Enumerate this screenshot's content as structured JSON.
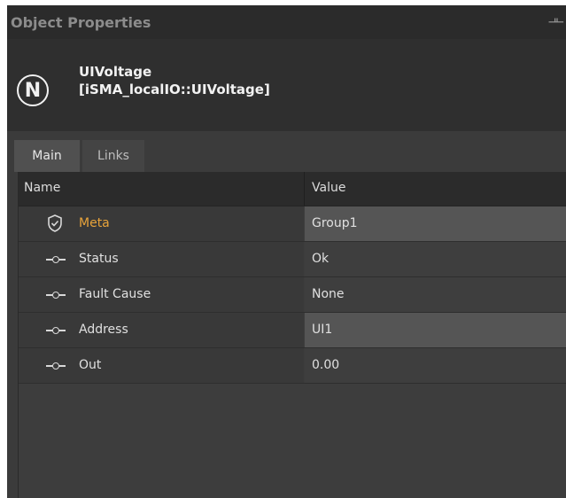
{
  "panel": {
    "title": "Object Properties",
    "pin_icon": "pin-icon"
  },
  "object": {
    "icon_letter": "N",
    "name": "UIVoltage",
    "type": "[iSMA_localIO::UIVoltage]"
  },
  "tabs": [
    {
      "label": "Main",
      "active": true
    },
    {
      "label": "Links",
      "active": false
    }
  ],
  "grid": {
    "columns": {
      "name": "Name",
      "value": "Value"
    },
    "rows": [
      {
        "icon": "shield-icon",
        "label": "Meta",
        "value": "Group1"
      },
      {
        "icon": "slot-icon",
        "label": "Status",
        "value": "Ok"
      },
      {
        "icon": "slot-icon",
        "label": "Fault Cause",
        "value": "None"
      },
      {
        "icon": "slot-icon",
        "label": "Address",
        "value": "UI1"
      },
      {
        "icon": "slot-icon",
        "label": "Out",
        "value": "0.00"
      }
    ]
  },
  "colors": {
    "meta_label": "#e7a33a",
    "background": "#3b3b3b"
  }
}
